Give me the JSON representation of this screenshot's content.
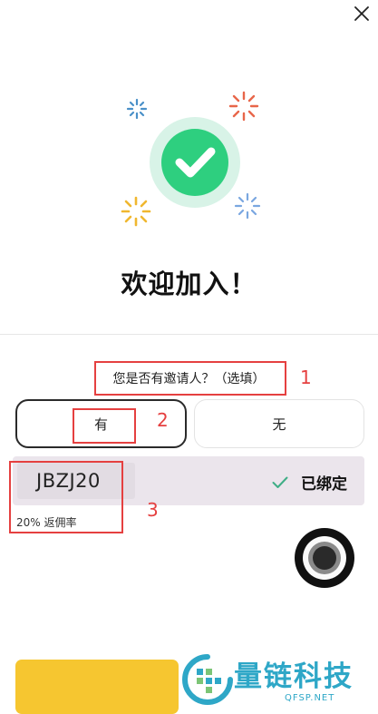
{
  "dialog": {
    "close_icon": "close-icon",
    "success_icon": "checkmark-icon",
    "title": "欢迎加入！"
  },
  "inviter": {
    "question": "您是否有邀请人？（选填）",
    "options": [
      {
        "label": "有",
        "selected": true
      },
      {
        "label": "无",
        "selected": false
      }
    ],
    "code": "JBZJ20",
    "status": "已绑定",
    "status_icon": "check-icon",
    "rate": "20% 返佣率"
  },
  "annotations": [
    "1",
    "2",
    "3"
  ],
  "watermark": {
    "name": "量链科技",
    "domain": "QFSP.NET"
  },
  "colors": {
    "success_green": "#2ecf7f",
    "accent_yellow": "#f6c630",
    "annotation_red": "#e54040",
    "code_row_bg": "#ebe5ec",
    "watermark_blue": "#2ea7c7"
  }
}
